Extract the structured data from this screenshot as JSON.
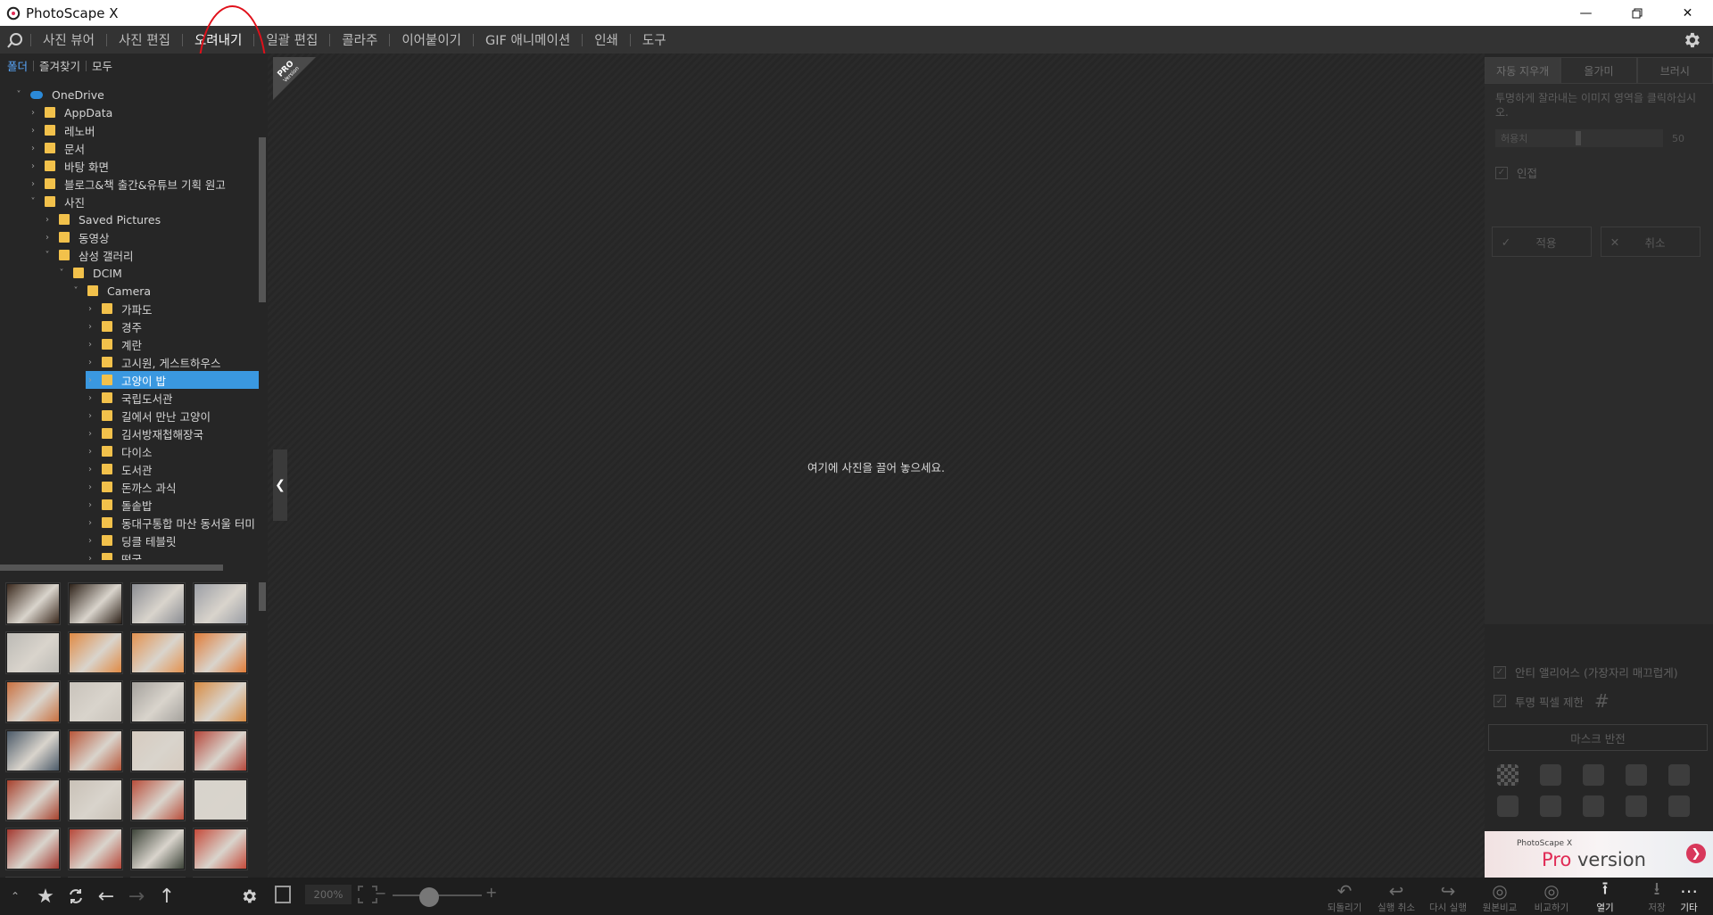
{
  "window": {
    "title": "PhotoScape X"
  },
  "menu": {
    "items": [
      {
        "id": "viewer",
        "label": "사진 뷰어"
      },
      {
        "id": "editor",
        "label": "사진 편집"
      },
      {
        "id": "cutout",
        "label": "오려내기"
      },
      {
        "id": "batch",
        "label": "일괄 편집"
      },
      {
        "id": "collage",
        "label": "콜라주"
      },
      {
        "id": "combine",
        "label": "이어붙이기"
      },
      {
        "id": "gif",
        "label": "GIF 애니메이션"
      },
      {
        "id": "print",
        "label": "인쇄"
      },
      {
        "id": "tools",
        "label": "도구"
      }
    ],
    "active": "오려내기"
  },
  "left": {
    "tabs": [
      "폴더",
      "즐겨찾기",
      "모두"
    ],
    "tree": [
      {
        "label": "OneDrive",
        "level": 0,
        "open": true,
        "icon": "cloud-icon"
      },
      {
        "label": "AppData",
        "level": 1
      },
      {
        "label": "레노버",
        "level": 1
      },
      {
        "label": "문서",
        "level": 1
      },
      {
        "label": "바탕 화면",
        "level": 1
      },
      {
        "label": "블로그&책 출간&유튜브 기획 원고",
        "level": 1
      },
      {
        "label": "사진",
        "level": 1,
        "open": true
      },
      {
        "label": "Saved Pictures",
        "level": 2
      },
      {
        "label": "동영상",
        "level": 2
      },
      {
        "label": "삼성 갤러리",
        "level": 2,
        "open": true
      },
      {
        "label": "DCIM",
        "level": 3,
        "open": true
      },
      {
        "label": "Camera",
        "level": 4,
        "open": true
      },
      {
        "label": "가파도",
        "level": 5
      },
      {
        "label": "경주",
        "level": 5
      },
      {
        "label": "계란",
        "level": 5
      },
      {
        "label": "고시원, 게스트하우스",
        "level": 5
      },
      {
        "label": "고양이 밥",
        "level": 5,
        "selected": true
      },
      {
        "label": "국립도서관",
        "level": 5
      },
      {
        "label": "길에서 만난 고양이",
        "level": 5
      },
      {
        "label": "김서방재첩해장국",
        "level": 5
      },
      {
        "label": "다이소",
        "level": 5
      },
      {
        "label": "도서관",
        "level": 5
      },
      {
        "label": "돈까스 과식",
        "level": 5
      },
      {
        "label": "돌솥밥",
        "level": 5
      },
      {
        "label": "동대구통합 마산 동서울 터미",
        "level": 5
      },
      {
        "label": "딩클 테블릿",
        "level": 5
      },
      {
        "label": "떡국",
        "level": 5
      }
    ],
    "thumb_colors": [
      [
        "#3b2a1e",
        "#2e2219",
        "#8b8d93",
        "#9b9ea5"
      ],
      [
        "#bcbab5",
        "#e08a44",
        "#e39250",
        "#e07c38"
      ],
      [
        "#c97140",
        "#c9c3bb",
        "#a5a29d",
        "#d88b42"
      ],
      [
        "#4b5a69",
        "#b8573a",
        "#d6cbc0",
        "#b5463a"
      ],
      [
        "#a7412d",
        "#c9c1b7",
        "#b94e3b",
        "#d7d3cc"
      ],
      [
        "#a3382f",
        "#b7483a",
        "#3d4439",
        "#c54a3a"
      ],
      [
        "#7b6654",
        "#6c5a47",
        "#8a3a30",
        "#9c3a33"
      ]
    ]
  },
  "center": {
    "drop_message": "여기에 사진을 끌어 놓으세요.",
    "badge_line1": "PRO",
    "badge_line2": "Version"
  },
  "right": {
    "tabs": [
      "자동 지우개",
      "올가미",
      "브러시"
    ],
    "description": "투명하게 잘라내는 이미지 영역을 클릭하십시오.",
    "slider_label": "허용치",
    "slider_value": "50",
    "check_adjacent": "인접",
    "apply_label": "적용",
    "cancel_label": "취소",
    "check_antialias": "안티 앨리어스 (가장자리 매끄럽게)",
    "check_trim": "투명 픽셀 제한",
    "mask_invert": "마스크 반전",
    "banner_small": "PhotoScape X",
    "banner_pro": "Pro",
    "banner_version": " version"
  },
  "bottom": {
    "zoom": "200%",
    "tools": [
      {
        "label": "되돌리기",
        "icon": "undo-icon"
      },
      {
        "label": "실행 취소",
        "icon": "undo-arrow-icon"
      },
      {
        "label": "다시 실행",
        "icon": "redo-arrow-icon"
      },
      {
        "label": "원본비교",
        "icon": "compare-original-icon"
      },
      {
        "label": "비교하기",
        "icon": "compare-icon"
      },
      {
        "label": "열기",
        "icon": "open-icon"
      },
      {
        "label": "저장",
        "icon": "save-icon"
      },
      {
        "label": "기타",
        "icon": "more-icon"
      }
    ]
  },
  "colors": {
    "accent": "#3a98e0",
    "highlight_circle": "#e0101a",
    "folder": "#f2c14b"
  }
}
